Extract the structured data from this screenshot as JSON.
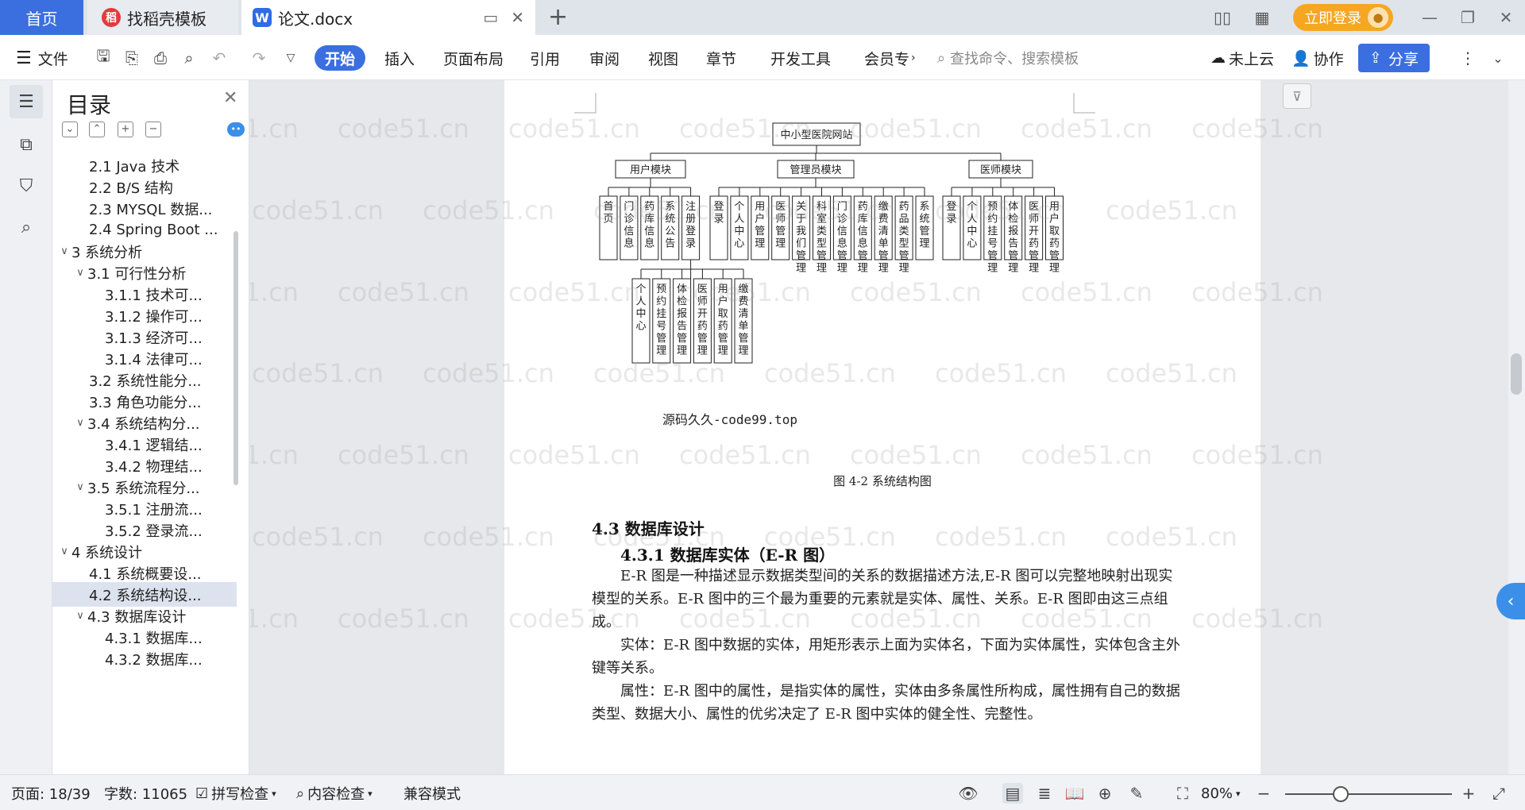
{
  "tabs": {
    "home": "首页",
    "daoke": "找稻壳模板",
    "doc": "论文.docx"
  },
  "titlebar": {
    "login": "立即登录"
  },
  "ribbon": {
    "file": "文件",
    "tabs": [
      "开始",
      "插入",
      "页面布局",
      "引用",
      "审阅",
      "视图",
      "章节",
      "开发工具",
      "会员专"
    ],
    "search": "查找命令、搜索模板",
    "cloud": "未上云",
    "collab": "协作",
    "share": "分享"
  },
  "toc": {
    "title": "目录",
    "items": [
      {
        "label": "2.1 Java 技术",
        "level": 2,
        "tw": ""
      },
      {
        "label": "2.2 B/S 结构",
        "level": 2,
        "tw": ""
      },
      {
        "label": "2.3 MYSQL 数据...",
        "level": 2,
        "tw": ""
      },
      {
        "label": "2.4 Spring Boot ...",
        "level": 2,
        "tw": ""
      },
      {
        "label": "3  系统分析",
        "level": 1,
        "tw": "v"
      },
      {
        "label": "3.1 可行性分析",
        "level": 2,
        "tw": "v"
      },
      {
        "label": "3.1.1 技术可...",
        "level": 3,
        "tw": ""
      },
      {
        "label": "3.1.2 操作可...",
        "level": 3,
        "tw": ""
      },
      {
        "label": "3.1.3 经济可...",
        "level": 3,
        "tw": ""
      },
      {
        "label": "3.1.4 法律可...",
        "level": 3,
        "tw": ""
      },
      {
        "label": "3.2 系统性能分...",
        "level": 2,
        "tw": ""
      },
      {
        "label": "3.3 角色功能分...",
        "level": 2,
        "tw": ""
      },
      {
        "label": "3.4 系统结构分...",
        "level": 2,
        "tw": "v"
      },
      {
        "label": "3.4.1 逻辑结...",
        "level": 3,
        "tw": ""
      },
      {
        "label": "3.4.2 物理结...",
        "level": 3,
        "tw": ""
      },
      {
        "label": "3.5 系统流程分...",
        "level": 2,
        "tw": "v"
      },
      {
        "label": "3.5.1 注册流...",
        "level": 3,
        "tw": ""
      },
      {
        "label": "3.5.2 登录流...",
        "level": 3,
        "tw": ""
      },
      {
        "label": "4  系统设计",
        "level": 1,
        "tw": "v"
      },
      {
        "label": "4.1 系统概要设...",
        "level": 2,
        "tw": ""
      },
      {
        "label": "4.2 系统结构设...",
        "level": 2,
        "tw": "",
        "active": true
      },
      {
        "label": "4.3 数据库设计",
        "level": 2,
        "tw": "v"
      },
      {
        "label": "4.3.1 数据库...",
        "level": 3,
        "tw": ""
      },
      {
        "label": "4.3.2 数据库...",
        "level": 3,
        "tw": ""
      }
    ]
  },
  "diagram": {
    "root": "中小型医院网站",
    "modules": [
      {
        "name": "用户模块",
        "children": [
          "首页",
          "门诊信息",
          "药库信息",
          "系统公告",
          "注册登录"
        ]
      },
      {
        "name": "管理员模块",
        "children": [
          "登录",
          "个人中心",
          "用户管理",
          "医师管理",
          "关于我们管理",
          "科室类型管理",
          "门诊信息管理",
          "药库信息管理",
          "缴费清单管理",
          "药品类型管理",
          "系统管理"
        ]
      },
      {
        "name": "医师模块",
        "children": [
          "登录",
          "个人中心",
          "预约挂号管理",
          "体检报告管理",
          "医师开药管理",
          "用户取药管理"
        ]
      }
    ],
    "sub_children": [
      "个人中心",
      "预约挂号管理",
      "体检报告管理",
      "医师开药管理",
      "用户取药管理",
      "缴费清单管理"
    ],
    "caption": "图 4-2 系统结构图",
    "source_mark": "源码久久-code99.top"
  },
  "doc": {
    "h2": "4.3  数据库设计",
    "h3": "4.3.1 数据库实体（E-R 图）",
    "p1": "E-R 图是一种描述显示数据类型间的关系的数据描述方法,E-R 图可以完整地映射出现实模型的关系。E-R 图中的三个最为重要的元素就是实体、属性、关系。E-R 图即由这三点组成。",
    "p2": "实体：E-R 图中数据的实体，用矩形表示上面为实体名，下面为实体属性，实体包含主外键等关系。",
    "p3": "属性：E-R 图中的属性，是指实体的属性，实体由多条属性所构成，属性拥有自己的数据类型、数据大小、属性的优劣决定了 E-R 图中实体的健全性、完整性。"
  },
  "watermark": "code51.cn",
  "status": {
    "page": "页面: 18/39",
    "words": "字数: 11065",
    "spell": "拼写检查",
    "content": "内容检查",
    "compat": "兼容模式",
    "zoom": "80%",
    "zoom_level": 0.8
  }
}
